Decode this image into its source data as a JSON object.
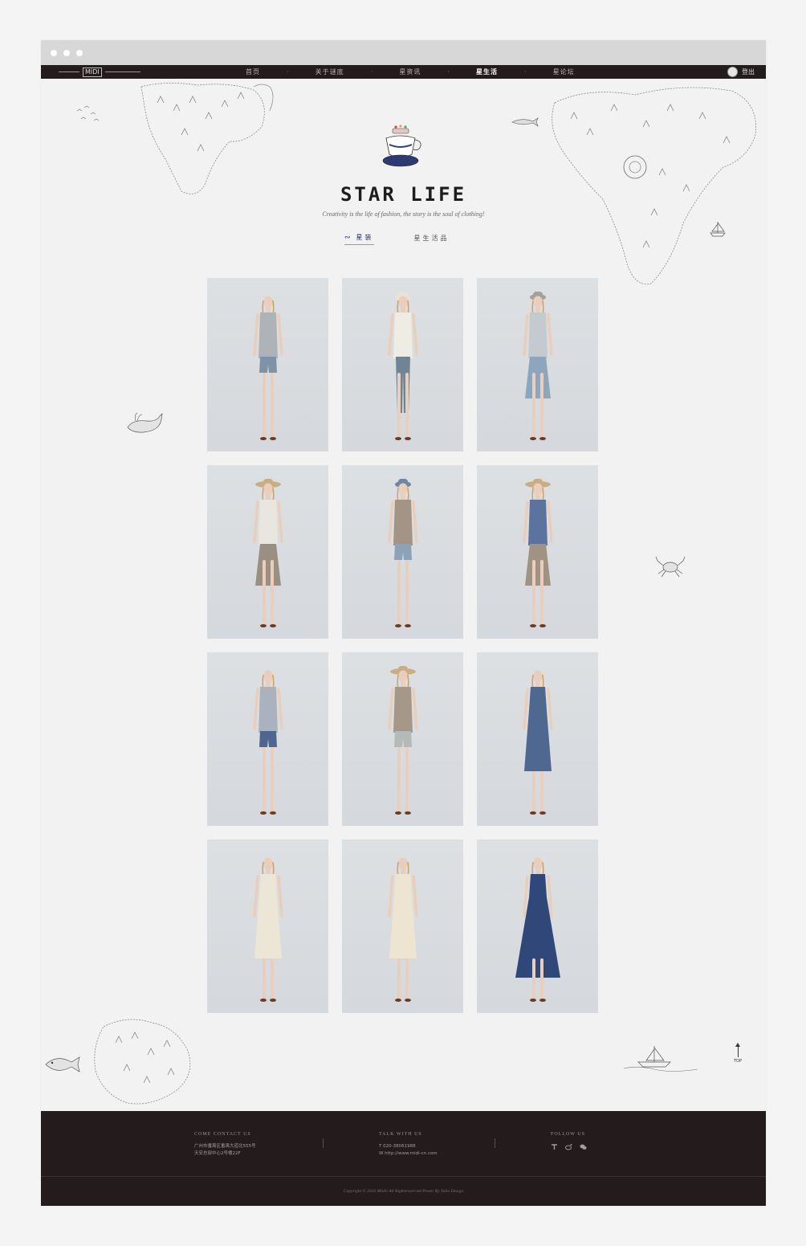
{
  "nav": {
    "logo": "MIDI",
    "items": [
      {
        "label": "首页",
        "active": false
      },
      {
        "label": "关于谜底",
        "active": false
      },
      {
        "label": "星资讯",
        "active": false
      },
      {
        "label": "星生活",
        "active": true
      },
      {
        "label": "星论坛",
        "active": false
      }
    ],
    "login": "登出"
  },
  "hero": {
    "title": "STAR LIFE",
    "tagline": "Creativity is the life of fashion, the story is the soul of clothing!",
    "tabs": [
      {
        "label": "星装",
        "active": true
      },
      {
        "label": "星生活品",
        "active": false
      }
    ]
  },
  "gallery": {
    "items": [
      {
        "outfit": "grey-top-denim-shorts",
        "top": "#aeb3b7",
        "bottom": "#7e93a7",
        "hat": ""
      },
      {
        "outfit": "white-blouse-jeans",
        "top": "#efece4",
        "bottom": "#6f8494",
        "hat": "#e8e3d8"
      },
      {
        "outfit": "cardigan-denim-skirt",
        "top": "#c4cace",
        "bottom": "#8ea6bd",
        "hat": "#a4a09c"
      },
      {
        "outfit": "overall-print-skirt",
        "top": "#e9e6df",
        "bottom": "#9b8f84",
        "hat": "#c9ad84"
      },
      {
        "outfit": "print-shirt-shorts",
        "top": "#a49485",
        "bottom": "#8ba2b8",
        "hat": "#6f85a5"
      },
      {
        "outfit": "blue-top-print-skirt",
        "top": "#5c73a0",
        "bottom": "#a19383",
        "hat": "#c9ad84"
      },
      {
        "outfit": "blue-patterned-dress",
        "top": "#aab3bd",
        "bottom": "#4f6691",
        "hat": ""
      },
      {
        "outfit": "striped-dress",
        "top": "#a69888",
        "bottom": "#b4bab8",
        "hat": "#c9ad84"
      },
      {
        "outfit": "navy-belted-dress",
        "top": "#4f6891",
        "bottom": "#4f6891",
        "hat": ""
      },
      {
        "outfit": "cream-dress-tote",
        "top": "#ece6d6",
        "bottom": "#ece6d6",
        "hat": ""
      },
      {
        "outfit": "cream-layered-dress",
        "top": "#ede5d1",
        "bottom": "#ede5d1",
        "hat": ""
      },
      {
        "outfit": "navy-maxi-dress",
        "top": "#2f4879",
        "bottom": "#2f4879",
        "hat": ""
      }
    ]
  },
  "top_button": "TOP",
  "footer": {
    "contact_title": "COME CONTACT US",
    "contact_line1": "广州市番禺区番禺大道北555号",
    "contact_line2": "天安总部中心2号楼22F",
    "talk_title": "TALK WITH US",
    "talk_phone": "T 020-38061988",
    "talk_web": "W http://www.midi-cn.com",
    "follow_title": "FOLLOW US",
    "social_icons": [
      "tieba-icon",
      "weibo-icon",
      "wechat-icon"
    ],
    "copyright": "Copyright © 2016 Miidii All Rightsreserved Power By Yulia Design"
  }
}
